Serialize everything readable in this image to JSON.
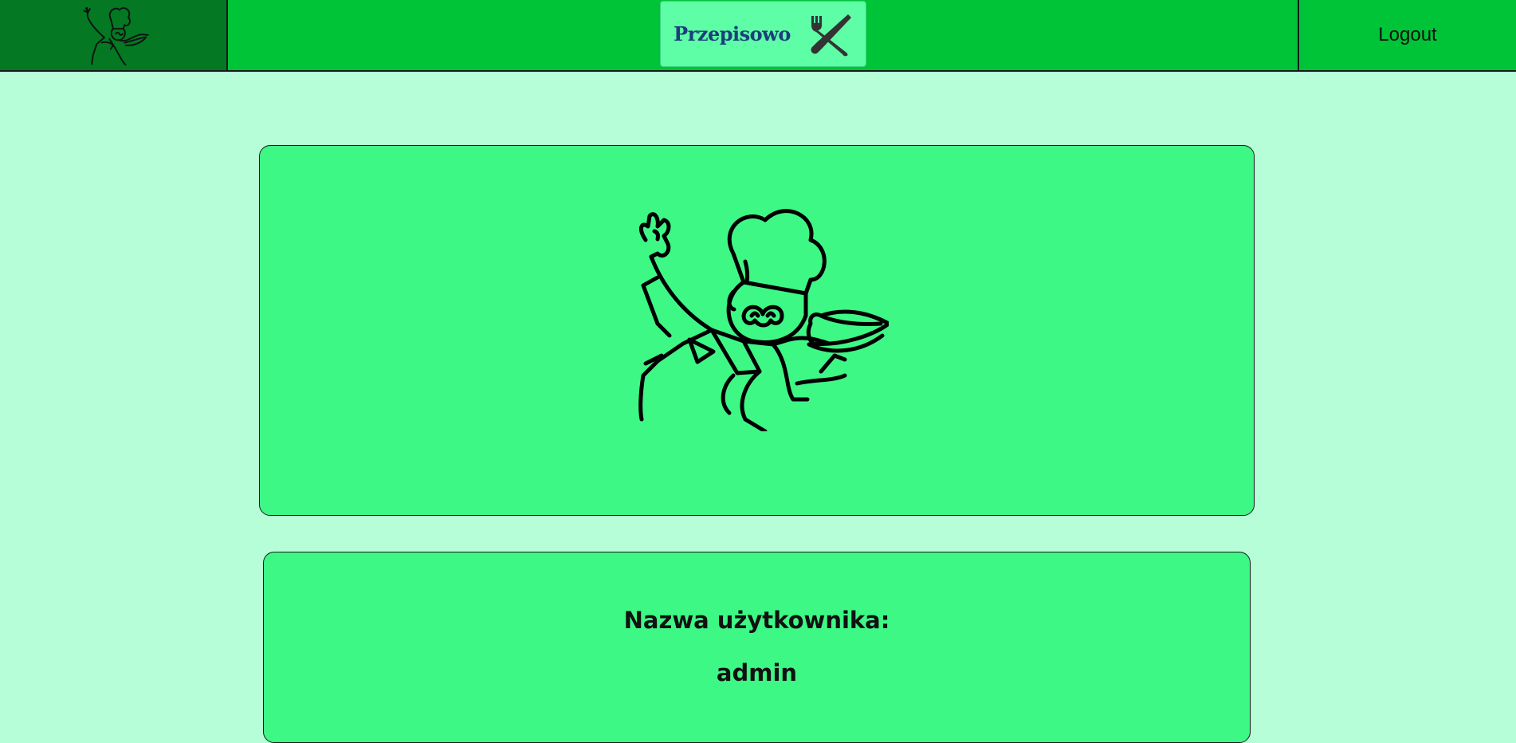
{
  "header": {
    "brand_name": "Przepisowo",
    "logout_label": "Logout",
    "colors": {
      "bar": "#00c437",
      "logo_cell": "#047823",
      "brand_box": "#5dfea6"
    },
    "icons": {
      "logo": "chef-logo-icon",
      "brand": "fork-knife-icon"
    }
  },
  "profile": {
    "avatar_icon": "chef-icon",
    "username_label": "Nazwa użytkownika:",
    "username_value": "admin"
  },
  "colors": {
    "page_background": "#b5fed8",
    "card_background": "#3ef885"
  }
}
